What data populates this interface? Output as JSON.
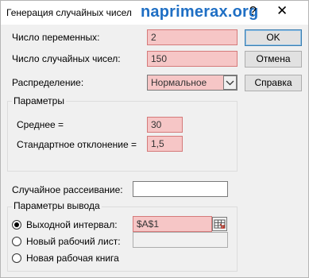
{
  "window": {
    "title": "Генерация случайных чисел",
    "watermark": "naprimerax.org",
    "help_glyph": "?",
    "close_glyph": "✕"
  },
  "fields": {
    "num_variables": {
      "label": "Число переменных:",
      "value": "2"
    },
    "num_random": {
      "label": "Число случайных чисел:",
      "value": "150"
    },
    "distribution": {
      "label": "Распределение:",
      "value": "Нормальное"
    }
  },
  "parameters": {
    "title": "Параметры",
    "mean": {
      "label": "Среднее =",
      "value": "30"
    },
    "stdev": {
      "label": "Стандартное отклонение =",
      "value": "1,5"
    }
  },
  "seed": {
    "label": "Случайное рассеивание:",
    "value": ""
  },
  "output": {
    "title": "Параметры вывода",
    "output_range": {
      "label": "Выходной интервал:",
      "value": "$A$1",
      "selected": true
    },
    "new_sheet": {
      "label": "Новый рабочий лист:",
      "value": ""
    },
    "new_workbook": {
      "label": "Новая рабочая книга"
    }
  },
  "buttons": {
    "ok": "OK",
    "cancel": "Отмена",
    "help": "Справка"
  },
  "colors": {
    "highlight_field": "#f6c6c6",
    "watermark": "#1f6fc4"
  }
}
